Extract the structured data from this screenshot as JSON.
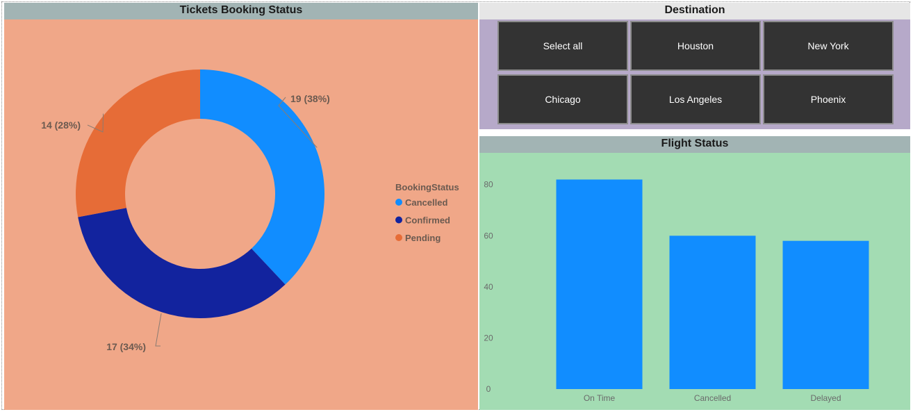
{
  "panels": {
    "booking_title": "Tickets Booking Status",
    "destination_title": "Destination",
    "flight_title": "Flight Status"
  },
  "destination": {
    "options": [
      "Select all",
      "Houston",
      "New York",
      "Chicago",
      "Los Angeles",
      "Phoenix"
    ]
  },
  "colors": {
    "cancelled": "#118dff",
    "confirmed": "#12239e",
    "pending": "#e66c37",
    "bar": "#118dff"
  },
  "chart_data": [
    {
      "type": "pie",
      "title": "Tickets Booking Status",
      "legend_title": "BookingStatus",
      "legend_position": "right",
      "slices": [
        {
          "label": "Cancelled",
          "value": 19,
          "display": "19 (38%)"
        },
        {
          "label": "Confirmed",
          "value": 17,
          "display": "17 (34%)"
        },
        {
          "label": "Pending",
          "value": 14,
          "display": "14 (28%)"
        }
      ]
    },
    {
      "type": "bar",
      "title": "Flight Status",
      "categories": [
        "On Time",
        "Cancelled",
        "Delayed"
      ],
      "values": [
        82,
        60,
        58
      ],
      "yticks": [
        0,
        20,
        40,
        60,
        80
      ],
      "ylim": [
        0,
        87
      ],
      "grid": false
    }
  ]
}
